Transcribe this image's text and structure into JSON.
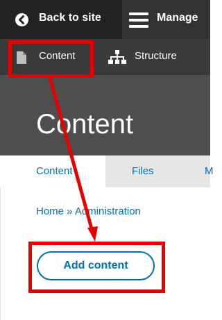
{
  "toolbar": {
    "back_label": "Back to site",
    "manage_label": "Manage",
    "back_icon": "chevron-left-circle-icon",
    "manage_icon": "hamburger-icon"
  },
  "tray": {
    "content_label": "Content",
    "structure_label": "Structure",
    "content_icon": "document-icon",
    "structure_icon": "sitemap-icon"
  },
  "page": {
    "title": "Content"
  },
  "tabs": [
    {
      "label": "Content",
      "active": true
    },
    {
      "label": "Files",
      "active": false
    },
    {
      "label": "M",
      "active": false
    }
  ],
  "breadcrumb": {
    "text": "Home » Administration"
  },
  "actions": {
    "add_content_label": "Add content"
  },
  "colors": {
    "toolbar_bg": "#222222",
    "tray_bg": "#3a3a3a",
    "title_bg": "#4e4e4e",
    "link": "#0071b8",
    "annotation": "#e60000"
  }
}
